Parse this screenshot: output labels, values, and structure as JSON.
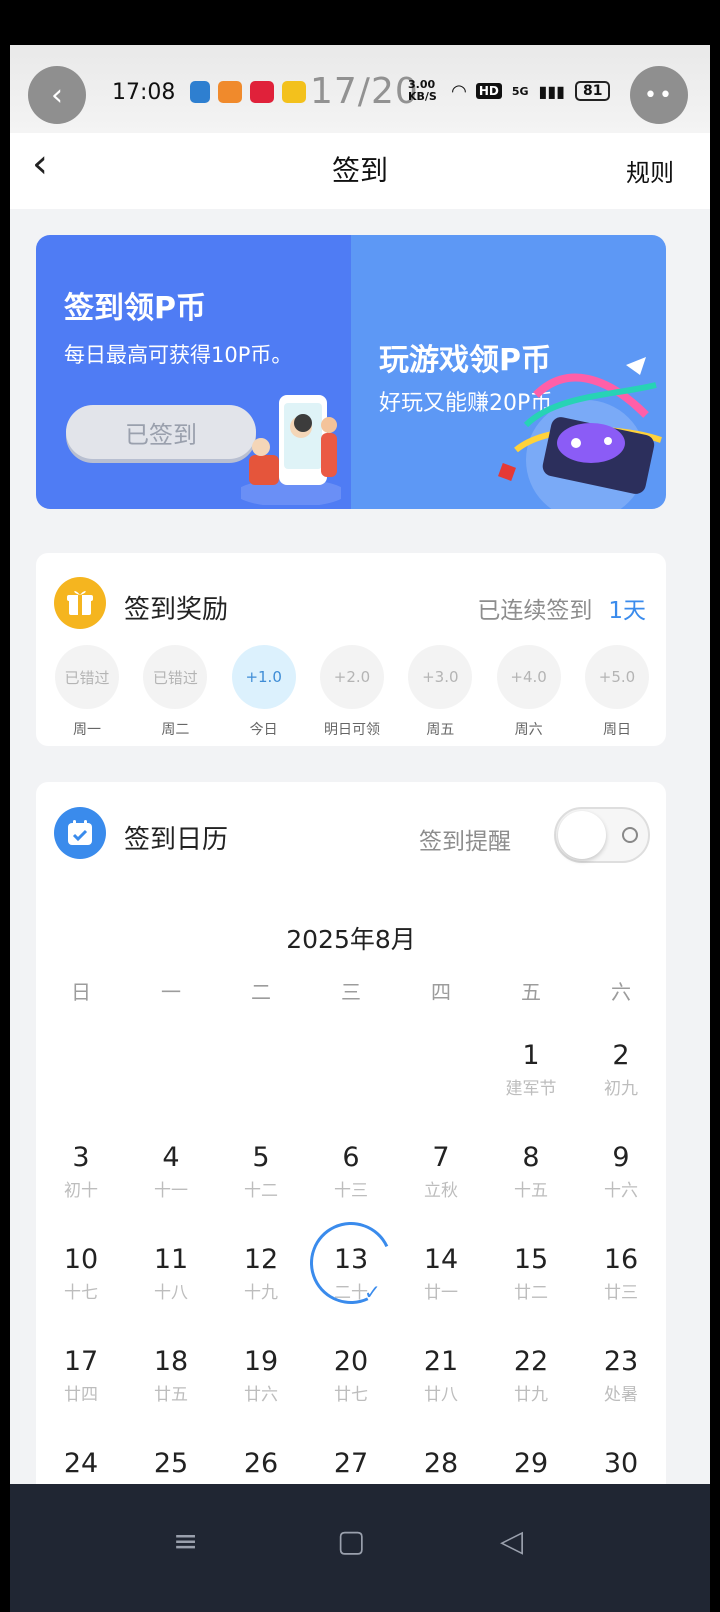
{
  "status_bar": {
    "time": "17:08",
    "page_counter": "17/20",
    "net_speed": "3.00 KB/S",
    "network": "5G",
    "battery": "81"
  },
  "nav": {
    "title": "签到",
    "rules_label": "规则"
  },
  "banner": {
    "left_title": "签到领P币",
    "left_subtitle": "每日最高可获得10P币。",
    "signed_button": "已签到",
    "right_title": "玩游戏领P币",
    "right_subtitle": "好玩又能赚20P币"
  },
  "rewards_card": {
    "title": "签到奖励",
    "streak_label": "已连续签到",
    "streak_days": "1天",
    "items": [
      {
        "value": "已错过",
        "label": "周一"
      },
      {
        "value": "已错过",
        "label": "周二"
      },
      {
        "value": "+1.0",
        "label": "今日"
      },
      {
        "value": "+2.0",
        "label": "明日可领"
      },
      {
        "value": "+3.0",
        "label": "周五"
      },
      {
        "value": "+4.0",
        "label": "周六"
      },
      {
        "value": "+5.0",
        "label": "周日"
      }
    ]
  },
  "calendar_card": {
    "title": "签到日历",
    "reminder_label": "签到提醒",
    "month": "2025年8月",
    "weekdays": [
      "日",
      "一",
      "二",
      "三",
      "四",
      "五",
      "六"
    ],
    "weeks": [
      [
        null,
        null,
        null,
        null,
        null,
        {
          "d": "1",
          "l": "建军节"
        },
        {
          "d": "2",
          "l": "初九"
        }
      ],
      [
        {
          "d": "3",
          "l": "初十"
        },
        {
          "d": "4",
          "l": "十一"
        },
        {
          "d": "5",
          "l": "十二"
        },
        {
          "d": "6",
          "l": "十三"
        },
        {
          "d": "7",
          "l": "立秋"
        },
        {
          "d": "8",
          "l": "十五"
        },
        {
          "d": "9",
          "l": "十六"
        }
      ],
      [
        {
          "d": "10",
          "l": "十七"
        },
        {
          "d": "11",
          "l": "十八"
        },
        {
          "d": "12",
          "l": "十九"
        },
        {
          "d": "13",
          "l": "二十",
          "today": true
        },
        {
          "d": "14",
          "l": "廿一"
        },
        {
          "d": "15",
          "l": "廿二"
        },
        {
          "d": "16",
          "l": "廿三"
        }
      ],
      [
        {
          "d": "17",
          "l": "廿四"
        },
        {
          "d": "18",
          "l": "廿五"
        },
        {
          "d": "19",
          "l": "廿六"
        },
        {
          "d": "20",
          "l": "廿七"
        },
        {
          "d": "21",
          "l": "廿八"
        },
        {
          "d": "22",
          "l": "廿九"
        },
        {
          "d": "23",
          "l": "处暑"
        }
      ],
      [
        {
          "d": "24",
          "l": ""
        },
        {
          "d": "25",
          "l": ""
        },
        {
          "d": "26",
          "l": ""
        },
        {
          "d": "27",
          "l": ""
        },
        {
          "d": "28",
          "l": ""
        },
        {
          "d": "29",
          "l": ""
        },
        {
          "d": "30",
          "l": ""
        }
      ]
    ]
  },
  "colors": {
    "accent": "#3a8bec",
    "banner_left": "#4f7cf4",
    "banner_right": "#5d98f5",
    "gift": "#f5b51f"
  }
}
